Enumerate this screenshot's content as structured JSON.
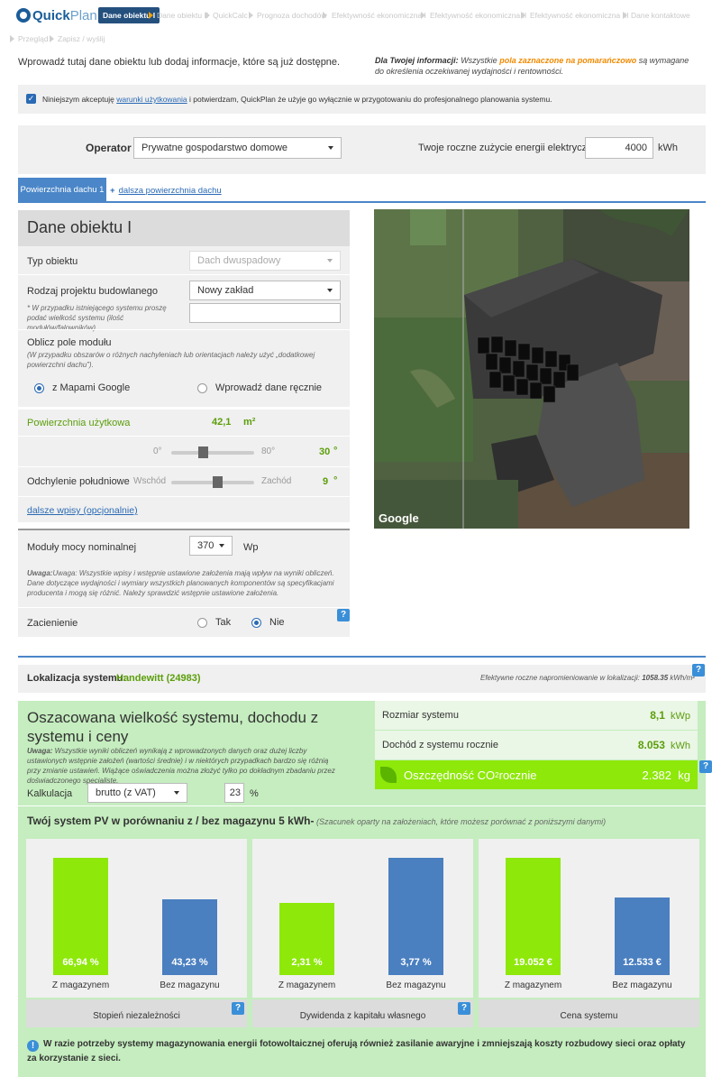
{
  "app": {
    "logo_bold": "Quick",
    "logo_light": "Plan"
  },
  "steps": [
    {
      "label": "Dane obiektu I",
      "active": true
    },
    {
      "label": "Dane obiektu II"
    },
    {
      "label": "QuickCalc"
    },
    {
      "label": "Prognoza dochodów"
    },
    {
      "label": "Efektywność ekonomiczna I"
    },
    {
      "label": "Efektywność ekonomiczna II"
    },
    {
      "label": "Efektywność ekonomiczna III"
    },
    {
      "label": "Dane kontaktowe"
    },
    {
      "label": "Przegląd"
    },
    {
      "label": "Zapisz / wyślij"
    }
  ],
  "intro": {
    "text": "Wprowadź tutaj dane obiektu lub dodaj informacje, które są już dostępne.",
    "info_bold": "Dla Twojej informacji:",
    "info_mid": " Wszystkie ",
    "info_orange": "pola zaznaczone na pomarańczowo",
    "info_end": " są wymagane do określenia oczekiwanej wydajności i rentowności."
  },
  "terms": {
    "pre": "Niniejszym akceptuję ",
    "link": "warunki użytkowania",
    "post": " i potwierdzam, QuickPlan że użyje go wyłącznie w przygotowaniu do profesjonalnego planowania systemu.",
    "checked": true
  },
  "operator": {
    "label": "Operator",
    "value": "Prywatne gospodarstwo domowe",
    "usage_label": "Twoje roczne zużycie energii elektrycznej",
    "usage_value": "4000",
    "usage_unit": "kWh"
  },
  "roof_tabs": {
    "active": "Powierzchnia dachu 1",
    "add": "dalsza powierzchnia dachu"
  },
  "object": {
    "title": "Dane obiektu I",
    "type_label": "Typ obiektu",
    "type_value": "Dach dwuspadowy",
    "project_label": "Rodzaj projektu budowlanego",
    "project_value": "Nowy zakład",
    "project_note": "* W przypadku istniejącego systemu proszę podać wielkość systemu (ilość modułów/falowników)",
    "module_field_label": "Oblicz pole modułu",
    "module_field_note": "(W przypadku obszarów o różnych nachyleniach lub orientacjach należy użyć „dodatkowej powierzchni dachu”).",
    "radio_google": "z Mapami Google",
    "radio_manual": "Wprowadź dane ręcznie",
    "area_label": "Powierzchnia użytkowa",
    "area_value": "42,1",
    "area_unit": "m²",
    "tilt_min": "0°",
    "tilt_max": "80°",
    "tilt_value": "30",
    "tilt_unit": "°",
    "tilt_level": 0.375,
    "azimuth_label": "Odchylenie południowe",
    "azimuth_left": "Wschód",
    "azimuth_right": "Zachód",
    "azimuth_value": "9",
    "azimuth_unit": "°",
    "azimuth_level": 0.55,
    "more_link": "dalsze wpisy (opcjonalnie)",
    "module_label": "Moduły mocy nominalnej",
    "module_value": "370",
    "module_unit": "Wp",
    "warning": "Uwaga: Wszystkie wpisy i wstępnie ustawione założenia mają wpływ na wyniki obliczeń. Dane dotyczące wydajności i wymiary wszystkich planowanych komponentów są specyfikacjami producenta i mogą się różnić. Należy sprawdzić wstępnie ustawione założenia.",
    "shading_label": "Zacienienie",
    "shading_yes": "Tak",
    "shading_no": "Nie"
  },
  "map": {
    "brand": "Google"
  },
  "location": {
    "label": "Lokalizacja systemu:",
    "value": "Handewitt (24983)",
    "irr_label": "Efektywne roczne napromieniowanie w lokalizacji:",
    "irr_value": "1058.35",
    "irr_unit": "kWh/m²"
  },
  "estimate": {
    "title": "Oszacowana wielkość systemu, dochodu z systemu i ceny",
    "note_bold": "Uwaga:",
    "note": " Wszystkie wyniki obliczeń wynikają z wprowadzonych danych oraz dużej liczby ustawionych wstępnie założeń (wartości średnie) i w niektórych przypadkach bardzo się różnią przy zmianie ustawień. Wiążące oświadczenia można złożyć tylko po dokładnym zbadaniu przez doświadczonego specjalistę.",
    "calc_label": "Kalkulacja",
    "calc_value": "brutto (z VAT)",
    "vat_value": "23",
    "vat_unit": "%",
    "size_label": "Rozmiar systemu",
    "size_value": "8,1",
    "size_unit": "kWp",
    "income_label": "Dochód z systemu rocznie",
    "income_value": "8.053",
    "income_unit": "kWh",
    "co2_label_a": "Oszczędność CO",
    "co2_sub": "2",
    "co2_label_b": " rocznie",
    "co2_value": "2.382",
    "co2_unit": "kg"
  },
  "compare": {
    "title": "Twój system PV w porównaniu z / bez magazynu 5 kWh-",
    "subtitle": " (Szacunek oparty na założeniach, które możesz porównać z poniższymi danymi)"
  },
  "colors": {
    "with": "#8ee80a",
    "without": "#4a7fc0",
    "accent": "#1e6b8c"
  },
  "chart_data": [
    {
      "type": "bar",
      "title": "Stopień niezależności",
      "categories": [
        "Z magazynem",
        "Bez magazynu"
      ],
      "values": [
        66.94,
        43.23
      ],
      "labels": [
        "66,94 %",
        "43,23 %"
      ],
      "unit": "%"
    },
    {
      "type": "bar",
      "title": "Dywidenda z kapitału własnego",
      "categories": [
        "Z magazynem",
        "Bez magazynu"
      ],
      "values": [
        2.31,
        3.77
      ],
      "labels": [
        "2,31 %",
        "3,77 %"
      ],
      "unit": "%"
    },
    {
      "type": "bar",
      "title": "Cena systemu",
      "categories": [
        "Z magazynem",
        "Bez magazynu"
      ],
      "values": [
        19052,
        12533
      ],
      "labels": [
        "19.052 €",
        "12.533 €"
      ],
      "unit": "€"
    }
  ],
  "footer_info": "W razie potrzeby systemy magazynowania energii fotowoltaicznej oferują również zasilanie awaryjne i zmniejszają koszty rozbudowy sieci oraz opłaty za korzystanie z sieci."
}
